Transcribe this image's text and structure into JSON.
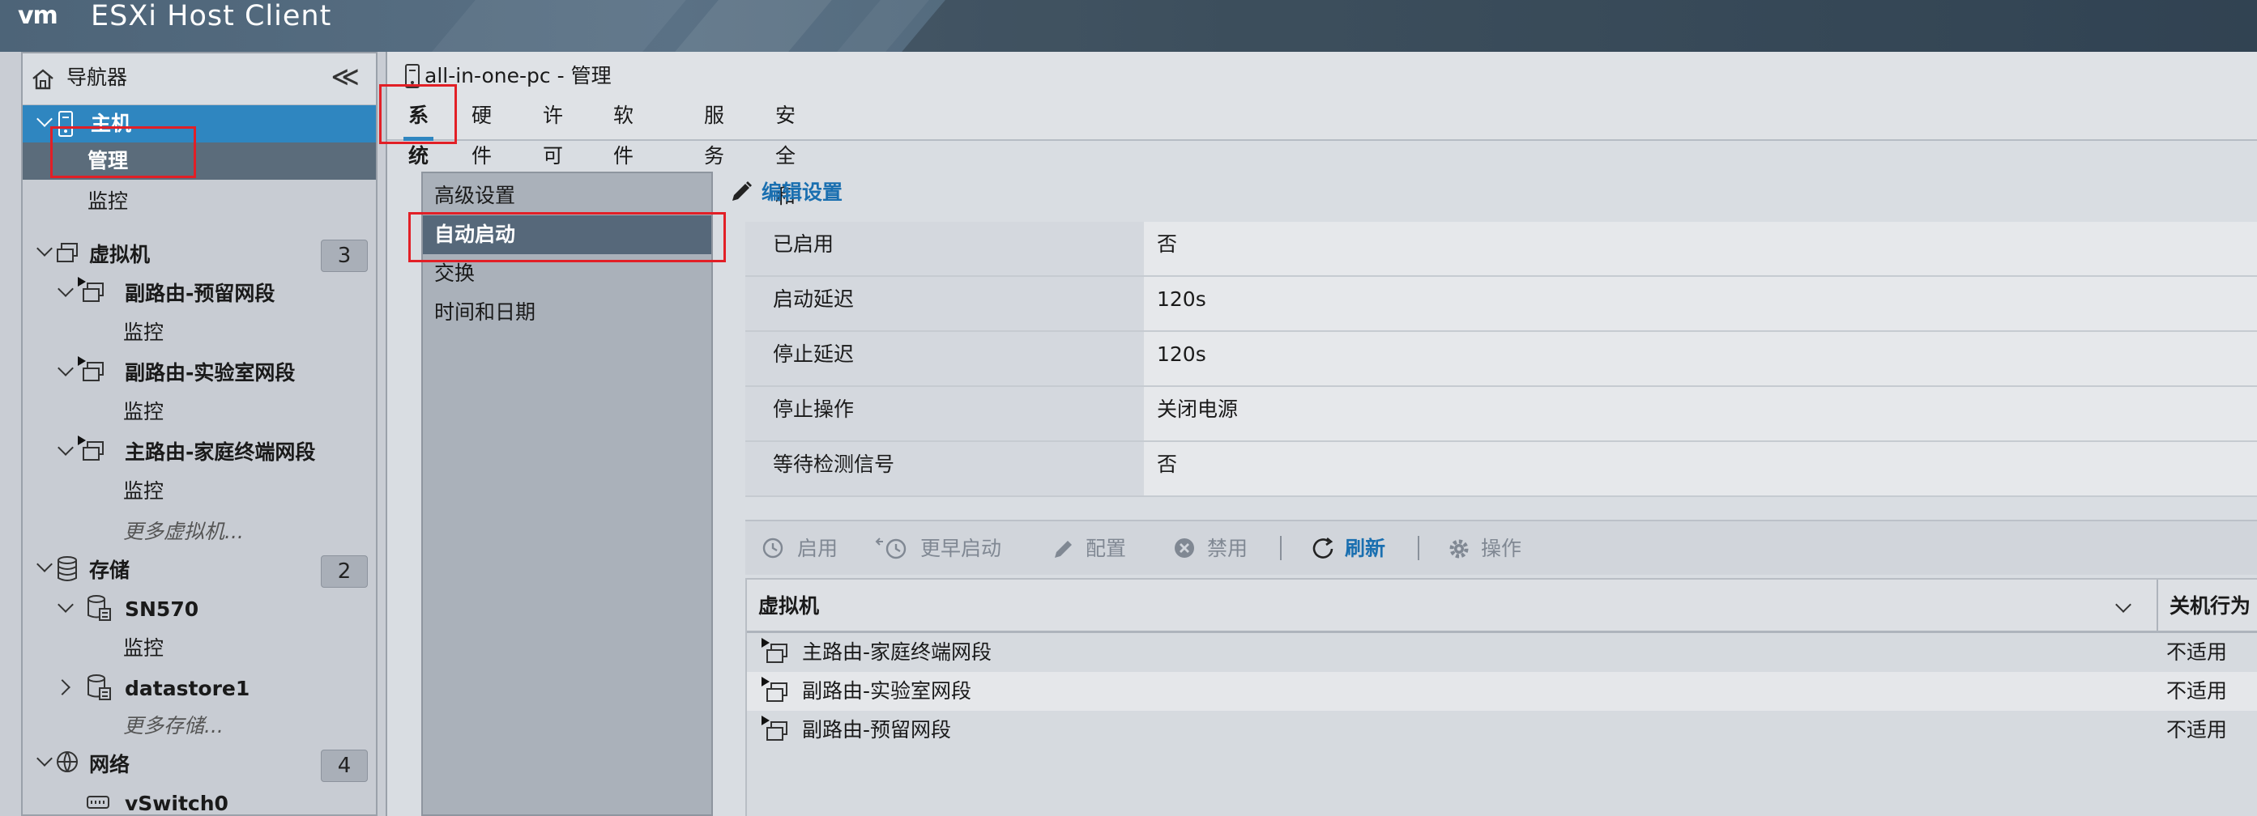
{
  "header": {
    "logo": "vm",
    "title": "ESXi Host Client"
  },
  "navigator": {
    "title": "导航器",
    "collapse": "≪",
    "host": {
      "label": "主机",
      "items": [
        "管理",
        "监控"
      ]
    },
    "vms": {
      "label": "虚拟机",
      "count": "3",
      "items": [
        {
          "label": "副路由-预留网段",
          "sub": "监控"
        },
        {
          "label": "副路由-实验室网段",
          "sub": "监控"
        },
        {
          "label": "主路由-家庭终端网段",
          "sub": "监控"
        }
      ],
      "more": "更多虚拟机..."
    },
    "storage": {
      "label": "存储",
      "count": "2",
      "items": [
        {
          "label": "SN570",
          "sub": "监控"
        },
        {
          "label": "datastore1"
        }
      ],
      "more": "更多存储..."
    },
    "network": {
      "label": "网络",
      "count": "4",
      "items": [
        "vSwitch0"
      ]
    }
  },
  "main": {
    "title": "all-in-one-pc - 管理",
    "tabs": [
      "系统",
      "硬件",
      "许可",
      "软件包",
      "服务",
      "安全和用户"
    ],
    "active_tab": "系统",
    "subnav": [
      "高级设置",
      "自动启动",
      "交换",
      "时间和日期"
    ],
    "active_subnav": "自动启动",
    "edit_label": "编辑设置",
    "properties": [
      {
        "key": "已启用",
        "value": "否"
      },
      {
        "key": "启动延迟",
        "value": "120s"
      },
      {
        "key": "停止延迟",
        "value": "120s"
      },
      {
        "key": "停止操作",
        "value": "关闭电源"
      },
      {
        "key": "等待检测信号",
        "value": "否"
      }
    ],
    "toolbar": {
      "enable": "启用",
      "earlier": "更早启动",
      "configure": "配置",
      "disable": "禁用",
      "refresh": "刷新",
      "actions": "操作"
    },
    "grid": {
      "col_vm": "虚拟机",
      "col_action": "关机行为",
      "rows": [
        {
          "vm": "主路由-家庭终端网段",
          "action": "不适用"
        },
        {
          "vm": "副路由-实验室网段",
          "action": "不适用"
        },
        {
          "vm": "副路由-预留网段",
          "action": "不适用"
        }
      ]
    }
  },
  "colors": {
    "accent": "#2f86c0",
    "highlight": "#e21f26",
    "link": "#1a6fb0"
  }
}
